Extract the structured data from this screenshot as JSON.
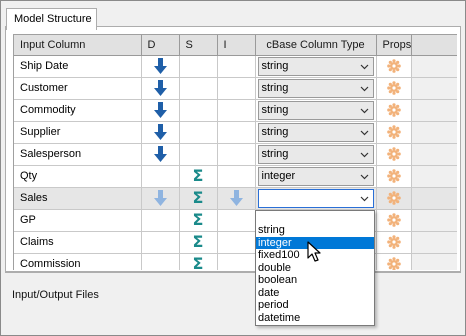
{
  "tab": {
    "label": "Model Structure"
  },
  "columns": {
    "input": "Input Column",
    "d": "D",
    "s": "S",
    "i": "I",
    "type": "cBase Column Type",
    "props": "Props"
  },
  "rows": [
    {
      "name": "Ship Date",
      "d": "down-arrow",
      "s": "",
      "i": "",
      "type": "string"
    },
    {
      "name": "Customer",
      "d": "down-arrow",
      "s": "",
      "i": "",
      "type": "string"
    },
    {
      "name": "Commodity",
      "d": "down-arrow",
      "s": "",
      "i": "",
      "type": "string"
    },
    {
      "name": "Supplier",
      "d": "down-arrow",
      "s": "",
      "i": "",
      "type": "string"
    },
    {
      "name": "Salesperson",
      "d": "down-arrow",
      "s": "",
      "i": "",
      "type": "string"
    },
    {
      "name": "Qty",
      "d": "",
      "s": "sigma",
      "i": "",
      "type": "integer"
    },
    {
      "name": "Sales",
      "d": "down-arrow-faded",
      "s": "sigma",
      "i": "down-arrow-faded",
      "type": "",
      "selected": true
    },
    {
      "name": "GP",
      "d": "",
      "s": "sigma",
      "i": "",
      "type": ""
    },
    {
      "name": "Claims",
      "d": "",
      "s": "sigma",
      "i": "",
      "type": ""
    },
    {
      "name": "Commission",
      "d": "",
      "s": "sigma",
      "i": "",
      "type": ""
    }
  ],
  "dropdown": {
    "options": [
      "string",
      "integer",
      "fixed100",
      "double",
      "boolean",
      "date",
      "period",
      "datetime"
    ],
    "highlighted": "integer"
  },
  "footer": {
    "label": "Input/Output Files"
  },
  "colors": {
    "arrow": "#1f5fa8",
    "arrow_faded": "#8fb4e0",
    "sigma": "#1a8a8a",
    "highlight": "#0078d7"
  }
}
